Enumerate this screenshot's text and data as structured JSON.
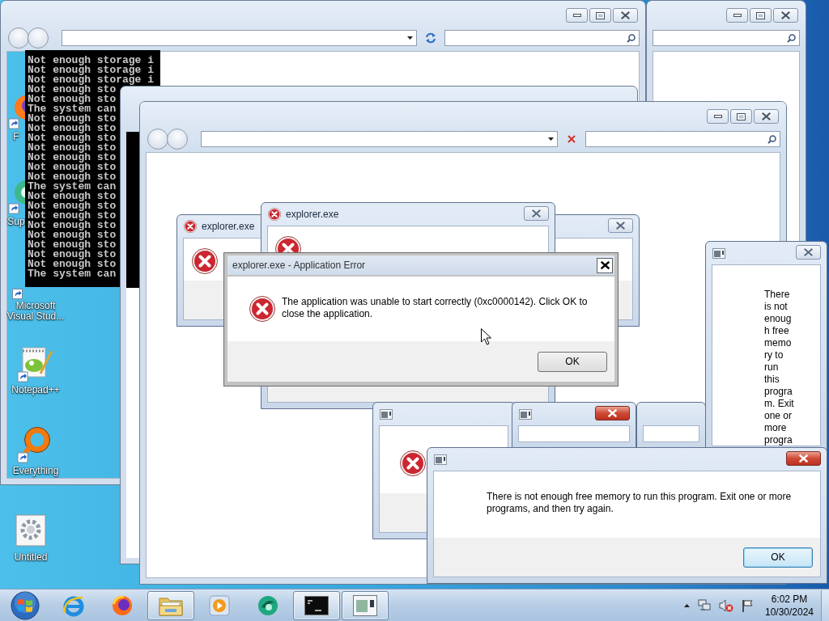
{
  "desktop_icons": [
    {
      "kind": "fox",
      "label": "F"
    },
    {
      "kind": "circle_app",
      "label": "Sup"
    },
    {
      "kind": "studio",
      "label": "Microsoft Visual Stud..."
    },
    {
      "kind": "notepad",
      "label": "Notepad++"
    },
    {
      "kind": "ring",
      "label": "Everything"
    },
    {
      "kind": "gear",
      "label": "Untitled"
    }
  ],
  "windows": [
    {
      "kind": "explorer"
    },
    {
      "kind": "explorer",
      "loading": false
    },
    {
      "kind": "console",
      "lines": [
        "Not enough storage i",
        "Not enough storage i",
        "Not enough storage i",
        "Not enough sto",
        "Not enough sto",
        "The system can",
        "Not enough sto",
        "Not enough sto",
        "Not enough sto",
        "Not enough sto",
        "Not enough sto",
        "Not enough sto",
        "Not enough sto",
        "The system can",
        "Not enough sto",
        "Not enough sto",
        "Not enough sto",
        "Not enough sto",
        "Not enough sto",
        "Not enough sto",
        "Not enough sto",
        "Not enough sto",
        "The system can"
      ]
    },
    {
      "kind": "frame"
    },
    {
      "kind": "explorer",
      "loading": true
    },
    {
      "kind": "error_dialog",
      "title": "explorer.exe",
      "active": false,
      "error_icon": true
    },
    {
      "kind": "error_dialog",
      "title": "explorer.exe",
      "active": false,
      "error_icon": true
    },
    {
      "kind": "classic_dialog",
      "title": "explorer.exe - Application Error",
      "error_icon": true,
      "message": "The application was unable to start correctly (0xc0000142). Click OK to close the application.",
      "button": {
        "label": "OK",
        "focused": false
      }
    },
    {
      "kind": "app_dialog",
      "error_icon": true
    },
    {
      "kind": "app_dialog",
      "active": true
    },
    {
      "kind": "blank_dialog"
    },
    {
      "kind": "app_dialog",
      "active": false,
      "message_lines": [
        "There",
        "is not",
        "enoug",
        "h free",
        "memo",
        "ry to",
        "run",
        "this",
        "progra",
        "m. Exit",
        "one or",
        "more",
        "progra"
      ]
    },
    {
      "kind": "app_dialog",
      "active": true,
      "message": "There is not enough free memory to run this program. Exit one or more programs, and then try again.",
      "button": {
        "label": "OK",
        "focused": true
      }
    }
  ],
  "taskbar": {
    "items": [
      {
        "kind": "e_browser",
        "running": false
      },
      {
        "kind": "fox_browser",
        "running": false
      },
      {
        "kind": "folder",
        "running": true
      },
      {
        "kind": "media",
        "running": false
      },
      {
        "kind": "circle_app",
        "running": false
      },
      {
        "kind": "terminal",
        "running": true
      },
      {
        "kind": "window",
        "running": true
      }
    ],
    "tray_icons": [
      {
        "kind": "chevron"
      },
      {
        "kind": "network"
      },
      {
        "kind": "volume_muted"
      },
      {
        "kind": "flag"
      }
    ],
    "clock": {
      "time": "6:02 PM",
      "date": "10/30/2024"
    }
  }
}
